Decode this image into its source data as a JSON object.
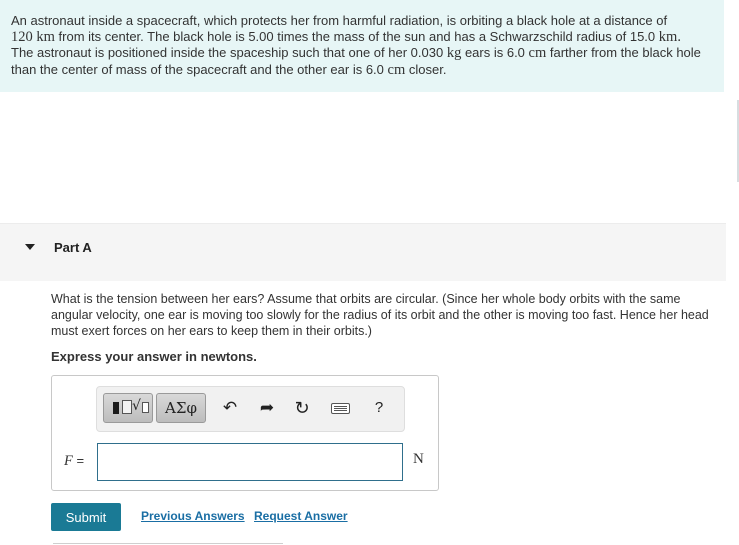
{
  "problem": {
    "line1_before": "An astronaut inside a spacecraft, which protects her from harmful radiation, is orbiting a black hole at a distance of",
    "distance_value": "120",
    "km_unit": "km",
    "line2_mid": "from its center. The black hole is 5.00 times the mass of the sun and has a Schwarzschild radius of 15.0",
    "line3_before": "The astronaut is positioned inside the spaceship such that one of her 0.030",
    "kg_unit": "kg",
    "line3_mid": "ears is 6.0",
    "cm_unit": "cm",
    "line3_after": "farther from the black hole",
    "line4_before": "than the center of mass of the spacecraft and the other ear is 6.0",
    "line4_after": "closer."
  },
  "part": {
    "title": "Part A"
  },
  "question": {
    "text": "What is the tension between her ears? Assume that orbits are circular. (Since her whole body orbits with the same angular velocity, one ear is moving too slowly for the radius of its orbit and the other is moving too fast. Hence her head must exert forces on her ears to keep them in their orbits.)",
    "instruction": "Express your answer in newtons."
  },
  "toolbar": {
    "symbols_label": "ΑΣφ",
    "undo_glyph": "↶",
    "redo_glyph": "➦",
    "reset_glyph": "↻",
    "help_label": "?"
  },
  "answer": {
    "variable": "F",
    "equals": "=",
    "value": "",
    "unit": "N"
  },
  "actions": {
    "submit_label": "Submit",
    "previous_answers_label": "Previous Answers",
    "request_answer_label": "Request Answer"
  }
}
